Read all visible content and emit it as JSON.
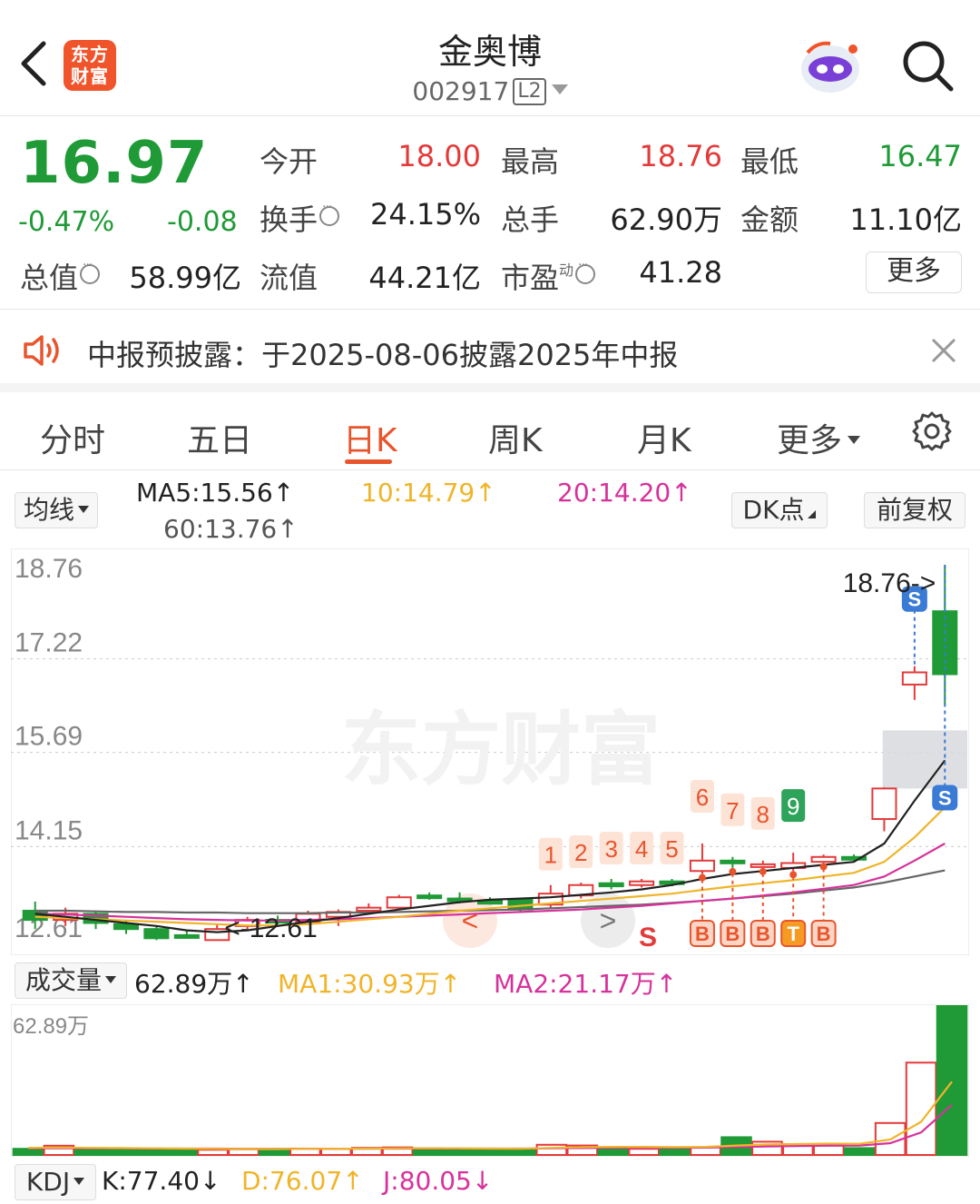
{
  "header": {
    "logo_text": "东方财富",
    "stock_name": "金奥博",
    "stock_code": "002917",
    "level_badge": "L2"
  },
  "quote": {
    "price": "16.97",
    "change_pct": "-0.47%",
    "change_amt": "-0.08",
    "open_label": "今开",
    "open": "18.00",
    "high_label": "最高",
    "high": "18.76",
    "low_label": "最低",
    "low": "16.47",
    "turnover_label": "换手",
    "turnover": "24.15%",
    "volume_label": "总手",
    "volume": "62.90万",
    "amount_label": "金额",
    "amount": "11.10亿",
    "mktcap_label": "总值",
    "mktcap": "58.99亿",
    "float_label": "流值",
    "float": "44.21亿",
    "pe_label": "市盈",
    "pe_sup": "动",
    "pe": "41.28",
    "more_label": "更多"
  },
  "notice": {
    "text": "中报预披露：于2025-08-06披露2025年中报"
  },
  "tabs": [
    {
      "label": "分时"
    },
    {
      "label": "五日"
    },
    {
      "label": "日K"
    },
    {
      "label": "周K"
    },
    {
      "label": "月K"
    },
    {
      "label": "更多"
    }
  ],
  "ma": {
    "selector": "均线",
    "ma5": "MA5:15.56↑",
    "ma10": "10:14.79↑",
    "ma20": "20:14.20↑",
    "ma60": "60:13.76↑",
    "dk_button": "DK点",
    "adjust_button": "前复权"
  },
  "colors": {
    "up": "#e33a3a",
    "down": "#1f9a36",
    "accent": "#e8552d",
    "ma5": "#222222",
    "ma10": "#f0b429",
    "ma20": "#d6329b",
    "ma60": "#666666"
  },
  "kchart": {
    "axis_labels": [
      "18.76",
      "17.22",
      "15.69",
      "14.15",
      "12.61"
    ],
    "high_marker": "18.76->",
    "low_marker": "<-12.61",
    "watermark": "东方财富",
    "numbers": [
      "1",
      "2",
      "3",
      "4",
      "5",
      "6",
      "7",
      "8",
      "9"
    ],
    "signals": [
      "B",
      "B",
      "B",
      "T",
      "B"
    ],
    "s_marker": "S",
    "s_bubble": "S",
    "nav_left": "<",
    "nav_right": ">"
  },
  "volume": {
    "selector": "成交量",
    "current": "62.89万↑",
    "ma1": "MA1:30.93万↑",
    "ma2": "MA2:21.17万↑",
    "axis_max": "62.89万"
  },
  "kdj": {
    "selector": "KDJ",
    "k": "K:77.40↓",
    "d": "D:76.07↑",
    "j": "J:80.05↓"
  },
  "chart_data": {
    "type": "candlestick",
    "ylim": [
      12.61,
      18.76
    ],
    "candles": [
      {
        "o": 13.1,
        "c": 12.95,
        "h": 13.25,
        "l": 12.8
      },
      {
        "o": 12.95,
        "c": 13.05,
        "h": 13.15,
        "l": 12.85
      },
      {
        "o": 13.05,
        "c": 12.9,
        "h": 13.1,
        "l": 12.8
      },
      {
        "o": 12.88,
        "c": 12.8,
        "h": 12.95,
        "l": 12.72
      },
      {
        "o": 12.8,
        "c": 12.65,
        "h": 12.85,
        "l": 12.62
      },
      {
        "o": 12.7,
        "c": 12.68,
        "h": 12.78,
        "l": 12.64
      },
      {
        "o": 12.62,
        "c": 12.8,
        "h": 12.88,
        "l": 12.61
      },
      {
        "o": 12.85,
        "c": 12.95,
        "h": 13.0,
        "l": 12.8
      },
      {
        "o": 12.95,
        "c": 12.92,
        "h": 13.02,
        "l": 12.88
      },
      {
        "o": 12.92,
        "c": 13.05,
        "h": 13.1,
        "l": 12.9
      },
      {
        "o": 13.0,
        "c": 13.08,
        "h": 13.12,
        "l": 12.85
      },
      {
        "o": 13.1,
        "c": 13.15,
        "h": 13.22,
        "l": 13.05
      },
      {
        "o": 13.15,
        "c": 13.32,
        "h": 13.36,
        "l": 13.12
      },
      {
        "o": 13.35,
        "c": 13.33,
        "h": 13.4,
        "l": 13.28
      },
      {
        "o": 13.3,
        "c": 13.28,
        "h": 13.4,
        "l": 13.22
      },
      {
        "o": 13.26,
        "c": 13.24,
        "h": 13.32,
        "l": 13.2
      },
      {
        "o": 13.28,
        "c": 13.12,
        "h": 13.3,
        "l": 13.08
      },
      {
        "o": 13.2,
        "c": 13.38,
        "h": 13.52,
        "l": 13.15
      },
      {
        "o": 13.35,
        "c": 13.52,
        "h": 13.56,
        "l": 13.3
      },
      {
        "o": 13.55,
        "c": 13.5,
        "h": 13.62,
        "l": 13.45
      },
      {
        "o": 13.52,
        "c": 13.58,
        "h": 13.62,
        "l": 13.48
      },
      {
        "o": 13.58,
        "c": 13.55,
        "h": 13.62,
        "l": 13.5
      },
      {
        "o": 13.75,
        "c": 13.92,
        "h": 14.2,
        "l": 13.7
      },
      {
        "o": 13.92,
        "c": 13.9,
        "h": 13.98,
        "l": 13.8
      },
      {
        "o": 13.85,
        "c": 13.86,
        "h": 13.92,
        "l": 13.8
      },
      {
        "o": 13.8,
        "c": 13.88,
        "h": 14.05,
        "l": 13.75
      },
      {
        "o": 13.9,
        "c": 13.98,
        "h": 14.02,
        "l": 13.88
      },
      {
        "o": 13.98,
        "c": 13.95,
        "h": 14.02,
        "l": 13.9
      },
      {
        "o": 14.6,
        "c": 15.1,
        "h": 15.12,
        "l": 14.4
      },
      {
        "o": 16.8,
        "c": 17.0,
        "h": 17.1,
        "l": 16.55
      },
      {
        "o": 18.0,
        "c": 16.97,
        "h": 18.76,
        "l": 16.47
      }
    ],
    "ma5": [
      13.05,
      13.0,
      12.95,
      12.9,
      12.85,
      12.78,
      12.75,
      12.78,
      12.85,
      12.92,
      12.98,
      13.05,
      13.12,
      13.18,
      13.24,
      13.28,
      13.3,
      13.32,
      13.36,
      13.4,
      13.45,
      13.52,
      13.62,
      13.7,
      13.75,
      13.8,
      13.85,
      13.9,
      14.2,
      14.9,
      15.56
    ],
    "ma10": [
      13.0,
      12.98,
      12.96,
      12.94,
      12.92,
      12.9,
      12.88,
      12.86,
      12.86,
      12.88,
      12.92,
      12.96,
      13.0,
      13.05,
      13.1,
      13.14,
      13.18,
      13.22,
      13.26,
      13.3,
      13.34,
      13.38,
      13.44,
      13.5,
      13.55,
      13.6,
      13.66,
      13.72,
      13.9,
      14.3,
      14.79
    ],
    "ma20": [
      13.05,
      13.04,
      13.02,
      13.0,
      12.98,
      12.96,
      12.95,
      12.94,
      12.94,
      12.95,
      12.96,
      12.98,
      13.0,
      13.02,
      13.04,
      13.06,
      13.08,
      13.1,
      13.12,
      13.15,
      13.18,
      13.22,
      13.26,
      13.3,
      13.35,
      13.4,
      13.46,
      13.52,
      13.66,
      13.92,
      14.2
    ],
    "ma60": [
      13.1,
      13.1,
      13.09,
      13.08,
      13.08,
      13.07,
      13.07,
      13.06,
      13.06,
      13.06,
      13.07,
      13.07,
      13.08,
      13.09,
      13.1,
      13.11,
      13.12,
      13.14,
      13.16,
      13.18,
      13.2,
      13.23,
      13.26,
      13.3,
      13.34,
      13.38,
      13.43,
      13.48,
      13.56,
      13.66,
      13.76
    ],
    "volume": [
      2.6,
      3.9,
      2.9,
      2.8,
      2.6,
      2.1,
      2.2,
      2.4,
      2.4,
      2.7,
      2.6,
      3.0,
      3.2,
      2.8,
      2.6,
      2.2,
      2.4,
      4.3,
      4.0,
      2.8,
      2.6,
      2.4,
      3.2,
      7.5,
      5.6,
      4.5,
      4.0,
      2.9,
      13.5,
      39.0,
      62.89
    ],
    "vol_ma1": [
      3.0,
      3.1,
      3.0,
      2.9,
      2.8,
      2.7,
      2.6,
      2.5,
      2.5,
      2.6,
      2.6,
      2.7,
      2.8,
      2.8,
      2.8,
      2.7,
      2.6,
      3.0,
      3.3,
      3.4,
      3.4,
      3.3,
      3.4,
      4.0,
      4.4,
      4.6,
      4.8,
      4.7,
      6.5,
      14.0,
      30.93
    ],
    "vol_ma2": [
      2.8,
      2.8,
      2.8,
      2.8,
      2.7,
      2.7,
      2.7,
      2.6,
      2.6,
      2.6,
      2.6,
      2.6,
      2.7,
      2.7,
      2.7,
      2.7,
      2.7,
      2.8,
      2.9,
      3.0,
      3.0,
      3.0,
      3.1,
      3.4,
      3.6,
      3.8,
      3.9,
      4.0,
      5.0,
      9.5,
      21.17
    ]
  }
}
